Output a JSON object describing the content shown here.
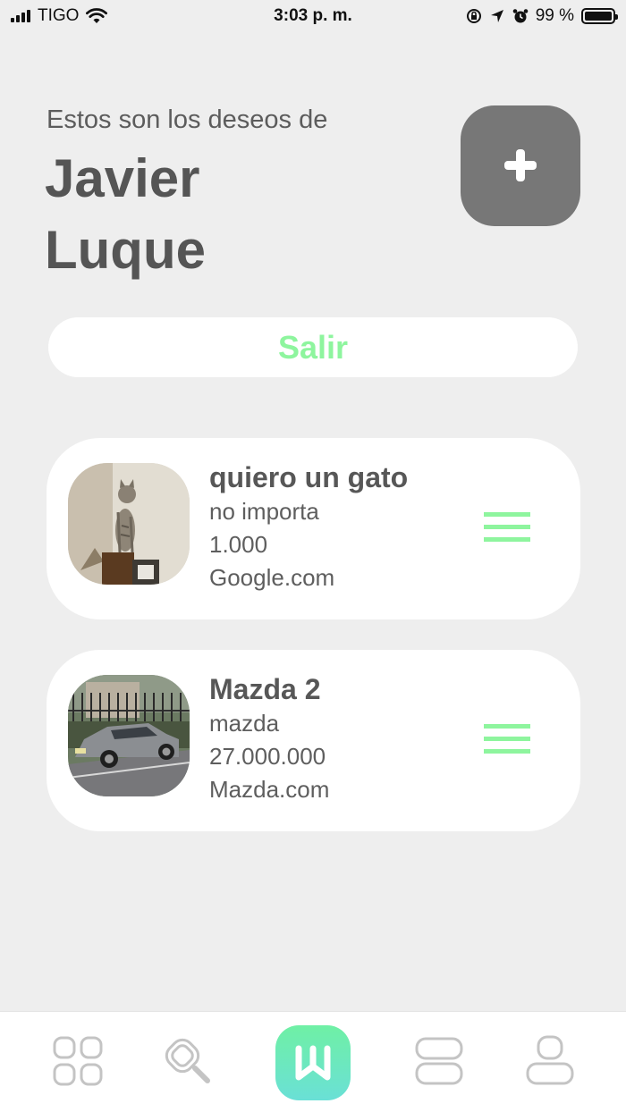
{
  "status_bar": {
    "carrier": "TIGO",
    "time": "3:03 p. m.",
    "battery": "99 %"
  },
  "header": {
    "subtitle": "Estos son los deseos de",
    "first_name": "Javier",
    "last_name": "Luque"
  },
  "logout_label": "Salir",
  "wishes": [
    {
      "title": "quiero un gato",
      "brand": "no importa",
      "price": "1.000",
      "site": "Google.com",
      "image": "cat-photo"
    },
    {
      "title": "Mazda 2",
      "brand": "mazda",
      "price": "27.000.000",
      "site": "Mazda.com",
      "image": "car-photo"
    }
  ],
  "colors": {
    "accent_green": "#8ef59e",
    "add_button": "#777777",
    "background": "#eeeeee",
    "nav_gradient_start": "#6ff0a5",
    "nav_gradient_end": "#6ae0d6"
  },
  "nav": [
    {
      "icon": "grid-icon"
    },
    {
      "icon": "search-icon"
    },
    {
      "icon": "wish-logo-icon",
      "active": true
    },
    {
      "icon": "list-icon"
    },
    {
      "icon": "profile-icon"
    }
  ]
}
